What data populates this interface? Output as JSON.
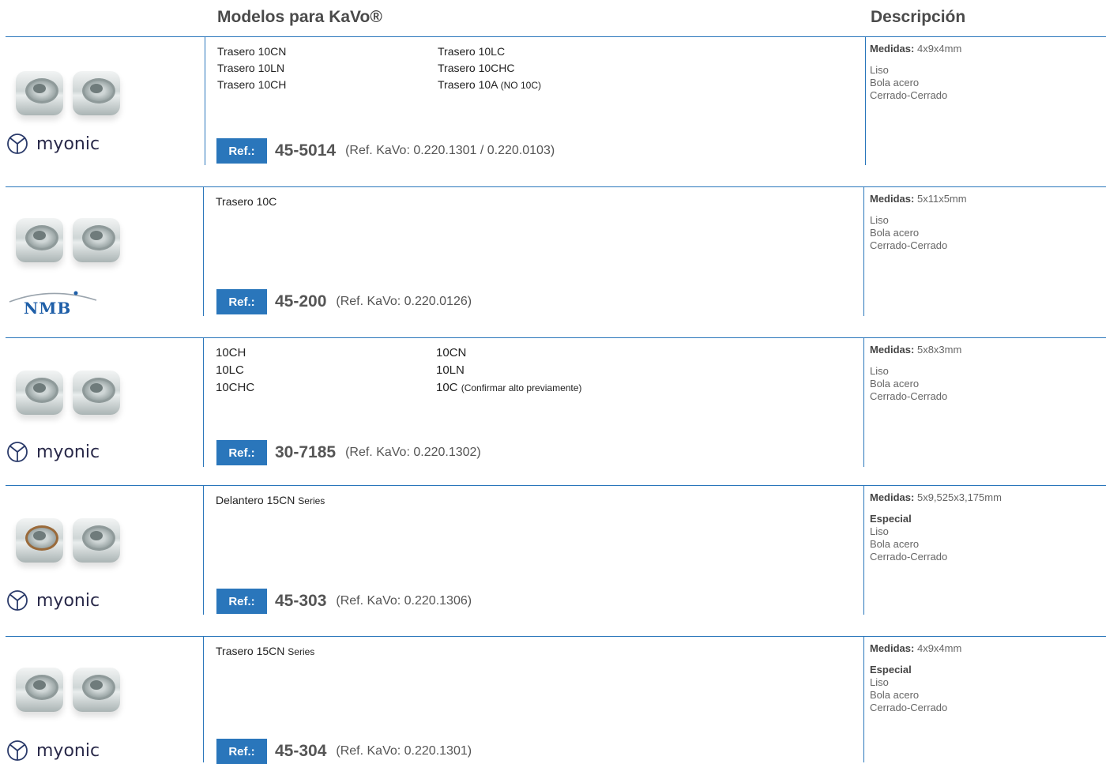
{
  "header": {
    "models_title": "Modelos para KaVo®",
    "desc_title": "Descripción"
  },
  "ref_label": "Ref.:",
  "rows": [
    {
      "brand": "myonic",
      "models_left": [
        "Trasero 10CN",
        "Trasero 10LN",
        "Trasero 10CH"
      ],
      "models_right": [
        "Trasero 10LC",
        "Trasero 10CHC"
      ],
      "models_right_last": "Trasero 10A",
      "models_right_last_note": "(NO 10C)",
      "ref_code": "45-5014",
      "ref_kavo": "(Ref. KaVo: 0.220.1301 / 0.220.0103)",
      "medidas_label": "Medidas:",
      "medidas": "4x9x4mm",
      "special": "",
      "desc_lines": [
        "Liso",
        "Bola acero",
        "Cerrado-Cerrado"
      ]
    },
    {
      "brand": "NMB",
      "model_single": "Trasero 10C",
      "ref_code": "45-200",
      "ref_kavo": "(Ref. KaVo: 0.220.0126)",
      "medidas_label": "Medidas:",
      "medidas": "5x11x5mm",
      "special": "",
      "desc_lines": [
        "Liso",
        "Bola acero",
        "Cerrado-Cerrado"
      ]
    },
    {
      "brand": "myonic",
      "models_left": [
        "10CH",
        "10LC",
        "10CHC"
      ],
      "models_right": [
        "10CN",
        "10LN"
      ],
      "models_right_last": "10C",
      "models_right_last_note": "(Confirmar alto previamente)",
      "ref_code": "30-7185",
      "ref_kavo": "(Ref. KaVo: 0.220.1302)",
      "medidas_label": "Medidas:",
      "medidas": "5x8x3mm",
      "special": "",
      "desc_lines": [
        "Liso",
        "Bola acero",
        "Cerrado-Cerrado"
      ]
    },
    {
      "brand": "myonic",
      "model_single": "Delantero 15CN",
      "model_single_note": "Series",
      "ref_code": "45-303",
      "ref_kavo": "(Ref. KaVo: 0.220.1306)",
      "medidas_label": "Medidas:",
      "medidas": "5x9,525x3,175mm",
      "special": "Especial",
      "desc_lines": [
        "Liso",
        "Bola acero",
        "Cerrado-Cerrado"
      ]
    },
    {
      "brand": "myonic",
      "model_single": "Trasero 15CN",
      "model_single_note": "Series",
      "ref_code": "45-304",
      "ref_kavo": "(Ref. KaVo: 0.220.1301)",
      "medidas_label": "Medidas:",
      "medidas": "4x9x4mm",
      "special": "Especial",
      "desc_lines": [
        "Liso",
        "Bola acero",
        "Cerrado-Cerrado"
      ]
    }
  ]
}
